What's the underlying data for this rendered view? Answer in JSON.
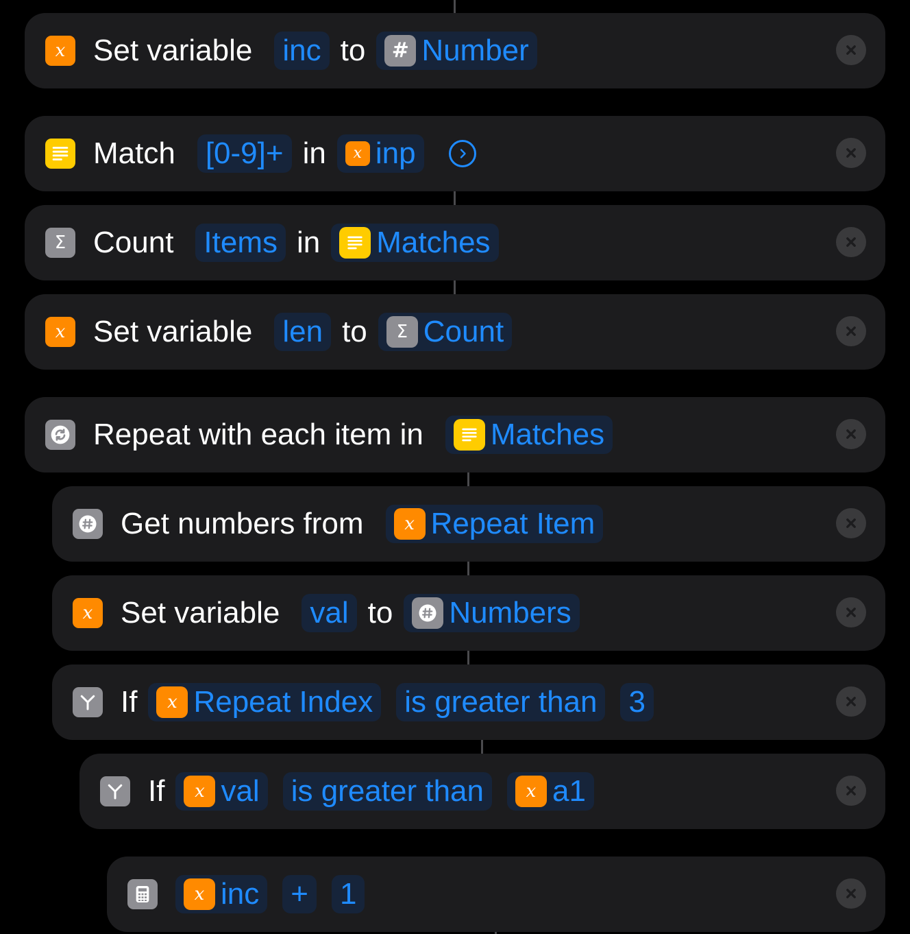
{
  "actions": [
    {
      "icon": "variable-icon",
      "label": "Set variable",
      "var": "inc",
      "word": "to",
      "value_icon": "number-icon",
      "value": "Number"
    },
    {
      "icon": "text-icon",
      "label": "Match",
      "pattern": "[0-9]+",
      "word": "in",
      "value_icon": "variable-icon",
      "value": "inp"
    },
    {
      "icon": "sigma-icon",
      "label": "Count",
      "what": "Items",
      "word": "in",
      "value_icon": "text-icon",
      "value": "Matches"
    },
    {
      "icon": "variable-icon",
      "label": "Set variable",
      "var": "len",
      "word": "to",
      "value_icon": "sigma-icon",
      "value": "Count"
    },
    {
      "icon": "repeat-icon",
      "label": "Repeat with each item in",
      "value_icon": "text-icon",
      "value": "Matches"
    },
    {
      "icon": "numbers-icon",
      "label": "Get numbers from",
      "value_icon": "variable-icon",
      "value": "Repeat Item"
    },
    {
      "icon": "variable-icon",
      "label": "Set variable",
      "var": "val",
      "word": "to",
      "value_icon": "numbers-icon",
      "value": "Numbers"
    },
    {
      "icon": "if-icon",
      "label": "If",
      "lhs": "Repeat Index",
      "op": "is greater than",
      "rhs": "3"
    },
    {
      "icon": "if-icon",
      "label": "If",
      "lhs": "val",
      "op": "is greater than",
      "rhs": "a1"
    },
    {
      "icon": "calculator-icon",
      "lhs": "inc",
      "op": "+",
      "rhs": "1"
    }
  ],
  "colors": {
    "accent": "#1f8bff",
    "variable": "#ff8a00",
    "text": "#ffcc00",
    "neutral": "#8e8e93",
    "card": "#1c1c1e"
  }
}
